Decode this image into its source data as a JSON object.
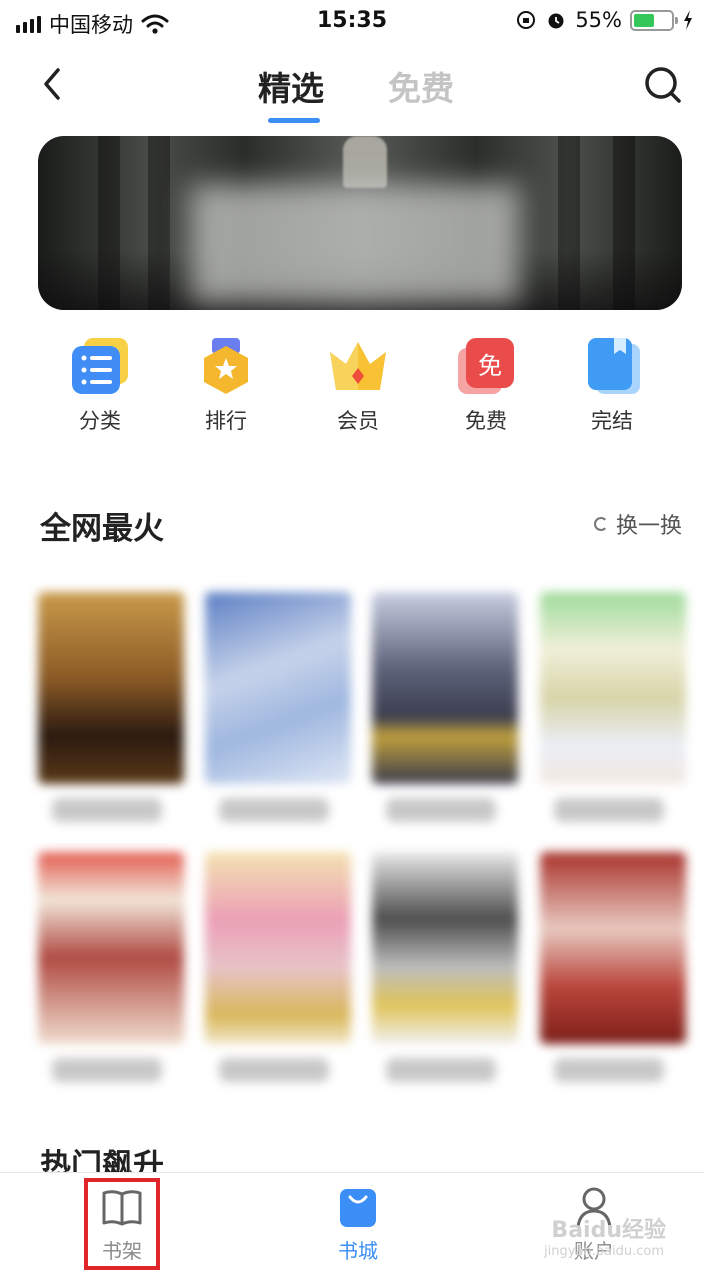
{
  "status_bar": {
    "carrier": "中国移动",
    "time": "15:35",
    "battery_pct": "55%",
    "battery_level": 0.55
  },
  "header": {
    "tabs": [
      {
        "label": "精选",
        "active": true
      },
      {
        "label": "免费",
        "active": false
      }
    ],
    "back_icon": "chevron-left-icon",
    "search_icon": "search-icon"
  },
  "categories": [
    {
      "label": "分类",
      "icon": "list-icon"
    },
    {
      "label": "排行",
      "icon": "ranking-badge-icon"
    },
    {
      "label": "会员",
      "icon": "crown-icon"
    },
    {
      "label": "免费",
      "icon": "free-badge-icon"
    },
    {
      "label": "完结",
      "icon": "finished-book-icon"
    }
  ],
  "section_hot": {
    "title": "全网最火",
    "refresh_label": "换一换"
  },
  "section_rising": {
    "title": "热门飙升"
  },
  "tabbar": {
    "items": [
      {
        "label": "书架",
        "icon": "bookshelf-icon",
        "active": false
      },
      {
        "label": "书城",
        "icon": "bookstore-bag-icon",
        "active": true
      },
      {
        "label": "账户",
        "icon": "account-icon",
        "active": false
      }
    ]
  },
  "watermark": {
    "text": "Baidu经验",
    "sub": "jingyan.baidu.com"
  },
  "colors": {
    "accent": "#3a8ef6",
    "highlight": "#e0252b"
  }
}
